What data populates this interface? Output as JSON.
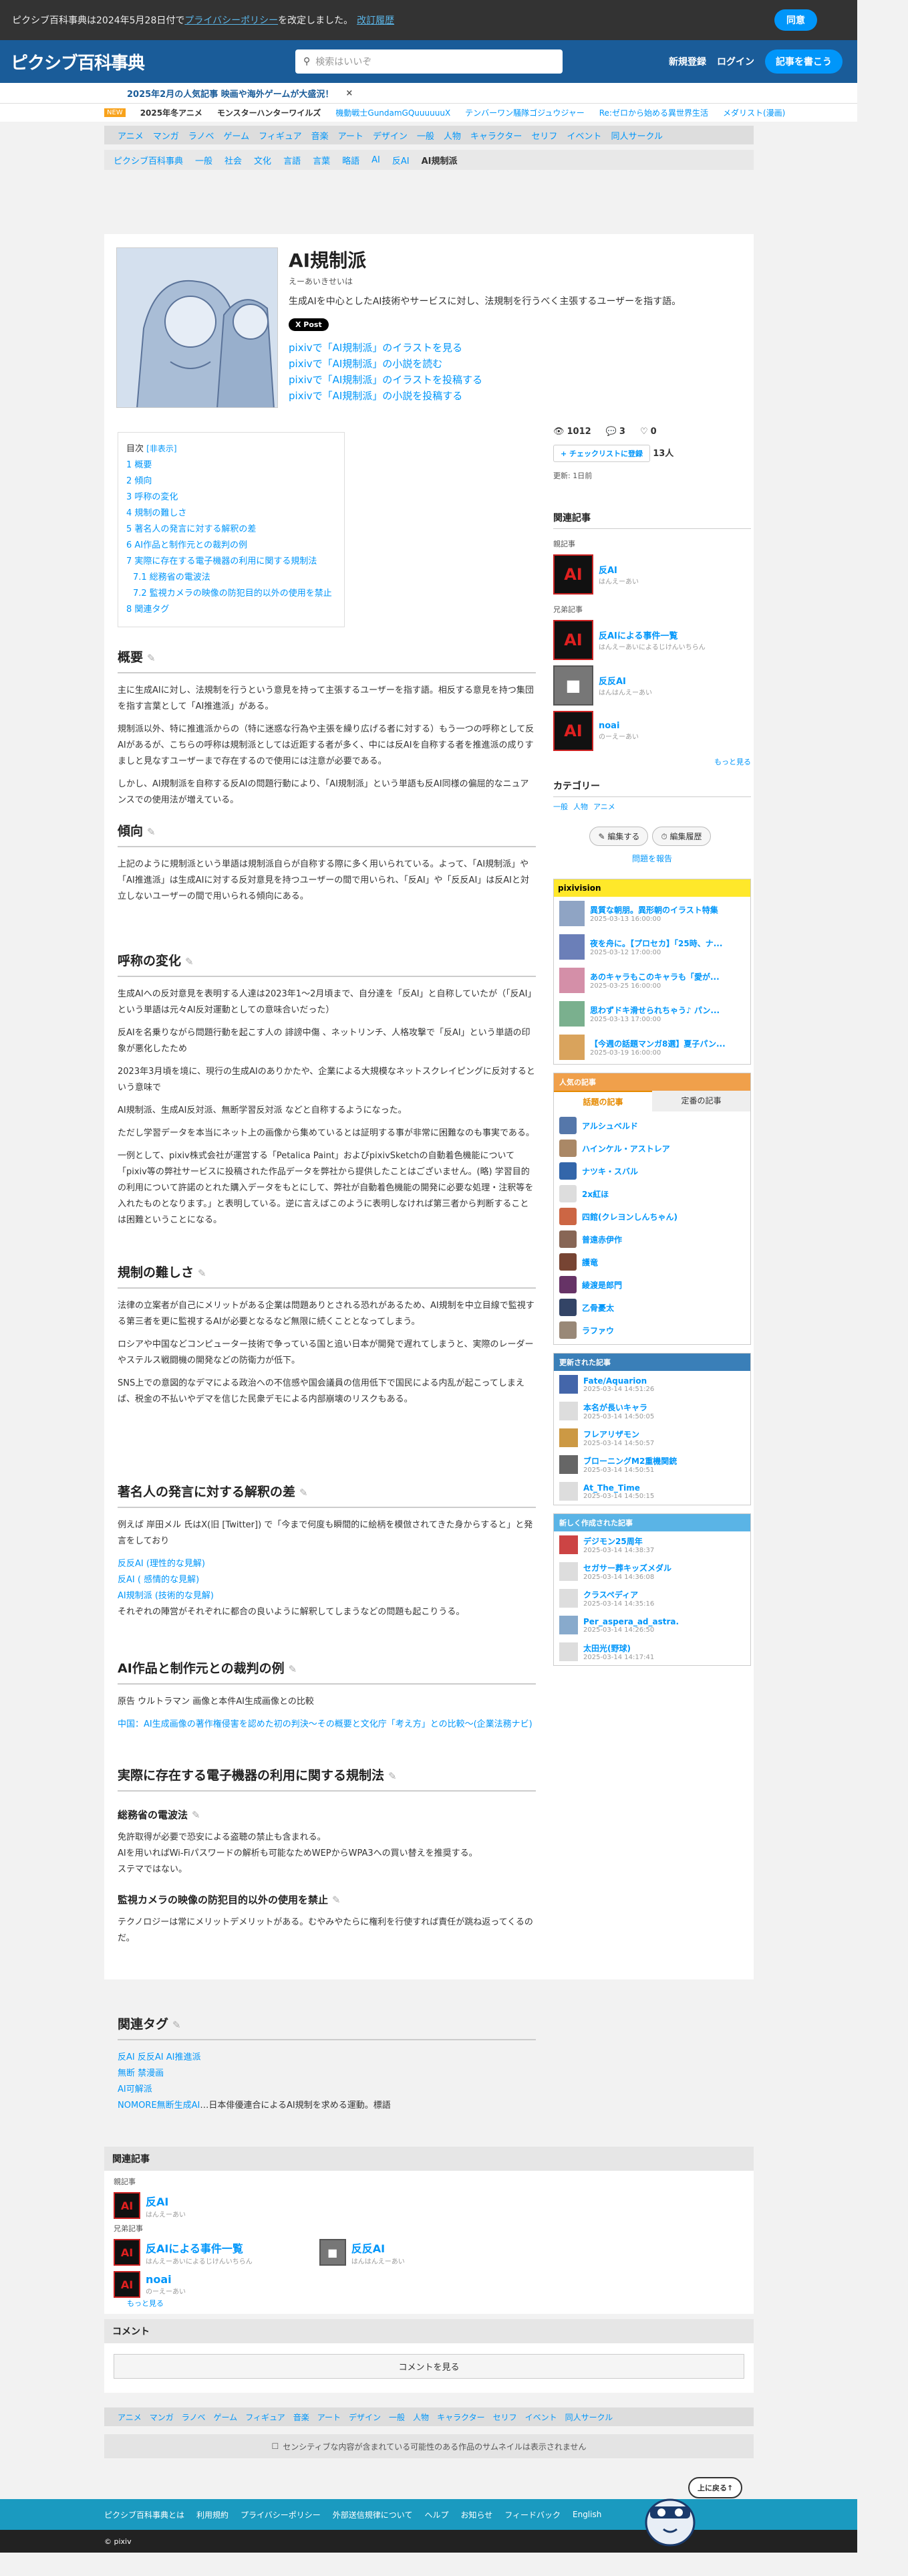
{
  "cookie": {
    "text": "ピクシブ百科事典は2024年5月28日付で",
    "link": "プライバシーポリシー",
    "text2": "を改定しました。",
    "history": "改訂履歴",
    "agree": "同意"
  },
  "header": {
    "logo": "ピクシブ百科事典",
    "search_placeholder": "検索はいいぞ",
    "register": "新規登録",
    "login": "ログイン",
    "write": "記事を書こう"
  },
  "promo": {
    "text": "2025年2月の人気記事 映画や海外ゲームが大盛況！",
    "close": "×"
  },
  "ticker": {
    "tag": "NEW",
    "items": [
      "2025年冬アニメ",
      "モンスターハンターワイルズ",
      "機動戦士GundamGQuuuuuuX",
      "テンバーワン騒隊ゴジュウジャー",
      "Re:ゼロから始める異世界生活",
      "メダリスト(漫画)"
    ]
  },
  "categories": [
    "アニメ",
    "マンガ",
    "ラノベ",
    "ゲーム",
    "フィギュア",
    "音楽",
    "アート",
    "デザイン",
    "一般",
    "人物",
    "キャラクター",
    "セリフ",
    "イベント",
    "同人サークル"
  ],
  "breadcrumb": [
    "ピクシブ百科事典",
    "一般",
    "社会",
    "文化",
    "言語",
    "言葉",
    "略語",
    "AI",
    "反AI",
    "AI規制派"
  ],
  "article": {
    "title": "AI規制派",
    "reading": "えーあいきせいは",
    "summary": "生成AIを中心としたAI技術やサービスに対し、法規制を行うべく主張するユーザーを指す語。",
    "post": "X Post",
    "pixiv_links": [
      "pixivで「AI規制派」のイラストを見る",
      "pixivで「AI規制派」の小説を読む",
      "pixivで「AI規制派」のイラストを投稿する",
      "pixivで「AI規制派」の小説を投稿する"
    ],
    "toc_title": "目次",
    "toc_toggle": "[非表示]",
    "toc": [
      "1 概要",
      "2 傾向",
      "3 呼称の変化",
      "4 規制の難しさ",
      "5 著名人の発言に対する解釈の差",
      "6 AI作品と制作元との裁判の例",
      "7 実際に存在する電子機器の利用に関する規制法"
    ],
    "toc_sub": [
      "7.1 総務省の電波法",
      "7.2 監視カメラの映像の防犯目的以外の使用を禁止"
    ],
    "toc_last": "8 関連タグ",
    "s1_title": "概要",
    "s1_p1": "主に生成AIに対し、法規制を行うという意見を持って主張するユーザーを指す語。相反する意見を持つ集団を指す言葉として「AI推進派」がある。",
    "s1_p2": "規制派以外、特に推進派からの（特に迷惑な行為や主張を繰り広げる者に対する）もう一つの呼称として反AIがあるが、こちらの呼称は規制派としては近距する者が多く、中には反AIを自称する者を推進派の成りすましと見なすユーザーまで存在するので使用には注意が必要である。",
    "s1_p3": "しかし、AI規制派を自称する反AIの問題行動により、「AI規制派」という単語も反AI同様の偏屈的なニュアンスでの使用法が増えている。",
    "s2_title": "傾向",
    "s2_p1": "上記のように規制派という単語は規制派自らが自称する際に多く用いられている。よって、「AI規制派」や「AI推進派」は生成AIに対する反対意見を持つユーザーの間で用いられ、「反AI」や「反反AI」は反AIと対立しないユーザーの間で用いられる傾向にある。",
    "s3_title": "呼称の変化",
    "s3_p1": "生成AIへの反対意見を表明する人達は2023年1〜2月頃まで、自分達を「反AI」と自称していたが（「反AI」という単語は元々AI反対運動としての意味合いだった）",
    "s3_p2": "反AIを名乗りながら問題行動を起こす人の 誹謗中傷 、ネットリンチ、人格攻撃で「反AI」という単語の印象が悪化したため",
    "s3_p3": "2023年3月頃を境に、現行の生成AIのありかたや、企業による大規模なネットスクレイピングに反対するという意味で",
    "s3_p4": "AI規制派、生成AI反対派、無断学習反対派 などと自称するようになった。",
    "s3_p5": "ただし学習データを本当にネット上の画像から集めているとは証明する事が非常に困難なのも事実である。",
    "s3_p6": "一例として、pixiv株式会社が運営する「Petalica Paint」およびpixivSketchの自動着色機能について「pixiv等の弊社サービスに投稿された作品データを弊社から提供したことはございません。(略) 学習目的の利用について許諾のとれた購入データをもとにして、弊社が自動着色機能の開発に必要な処理・注釈等を入れたものとなります。」と表明している。逆に言えばこのように表明しなければ第三者から判断することは困難ということになる。",
    "s4_title": "規制の難しさ",
    "s4_p1": "法律の立案者が自己にメリットがある企業は問題ありとされる恐れがあるため、AI規制を中立目線で監視する第三者を更に監視するAIが必要となるなど無限に続くこととなってしまう。",
    "s4_p2": "ロシアや中国などコンピューター技術で争っている国と追い日本が開発で遅れてしまうと、実際のレーダーやステルス戦闘機の開発などの防衛力が低下。",
    "s4_p3": "SNS上での意図的なデマによる政治への不信感や国会議員の信用低下で国民による内乱が起こってしまえば、税金の不払いやデマを信じた民衆デモによる内部崩壊のリスクもある。",
    "s5_title": "著名人の発言に対する解釈の差",
    "s5_p1": "例えば 岸田メル 氏はX(旧 [Twitter]) で「今まで何度も瞬間的に絵柄を模倣されてきた身からすると」と発言をしており",
    "s5_l1": "反反AI (理性的な見解)",
    "s5_l2": "反AI ( 感情的な見解)",
    "s5_l3": "AI規制派 (技術的な見解)",
    "s5_p2": "それぞれの陣営がそれぞれに都合の良いように解釈してしまうなどの問題も起こりうる。",
    "s6_title": "AI作品と制作元との裁判の例",
    "s6_p1": "原告 ウルトラマン 画像と本件AI生成画像との比較",
    "s6_p2": "中国：AI生成画像の著作権侵害を認めた初の判決〜その概要と文化庁「考え方」との比較〜(企業法務ナビ)",
    "s7_title": "実際に存在する電子機器の利用に関する規制法",
    "s71_title": "総務省の電波法",
    "s71_p1": "免許取得が必要で恐安による盗聴の禁止も含まれる。",
    "s71_p2": "AIを用いればWi-Fiパスワードの解析も可能なためWEPからWPA3への買い替えを推奨する。",
    "s71_p3": "ステマではない。",
    "s72_title": "監視カメラの映像の防犯目的以外の使用を禁止",
    "s72_p1": "テクノロジーは常にメリットデメリットがある。むやみやたらに権利を行使すれば責任が跳ね返ってくるのだ。",
    "s8_title": "関連タグ",
    "s8_l1": "反AI 反反AI AI推進派",
    "s8_l2": "無断 禁漫画",
    "s8_l3": "AI可解派",
    "s8_l4": "NOMORE無断生成AI",
    "s8_l4b": "…日本俳優連合によるAI規制を求める運動。標語"
  },
  "stats": {
    "views": "1012",
    "comments": "3",
    "likes": "0",
    "checklist": "チェックリストに登録",
    "check_count": "13人",
    "updated": "更新: 1日前"
  },
  "sidebar": {
    "related_title": "関連記事",
    "parent_label": "親記事",
    "parent": {
      "name": "反AI",
      "sub": "はんえーあい"
    },
    "sibling_label": "兄弟記事",
    "siblings": [
      {
        "name": "反AIによる事件一覧",
        "sub": "はんえーあいによるじけんいちらん"
      },
      {
        "name": "反反AI",
        "sub": "はんはんえーあい"
      },
      {
        "name": "noai",
        "sub": "のーえーあい"
      }
    ],
    "more": "もっと見る",
    "category_title": "カテゴリー",
    "category": [
      "一般",
      "人物",
      "アニメ"
    ],
    "edit": "編集する",
    "history": "編集履歴",
    "report": "問題を報告",
    "pixivision": "pixivision",
    "pv_items": [
      {
        "t": "異質な朝朋。異形朝のイラスト特集",
        "d": "2025-03-13 16:00:00"
      },
      {
        "t": "夜を舟に。【プロセカ】「25時、ナ...",
        "d": "2025-03-12 17:00:00"
      },
      {
        "t": "あのキャラもこのキャラも「愛が...",
        "d": "2025-03-25 16:00:00"
      },
      {
        "t": "思わずドキ滑せられちゃう♪ パン...",
        "d": "2025-03-13 17:00:00"
      },
      {
        "t": "【今週の話題マンガ8選】夏子パン...",
        "d": "2025-03-19 16:00:00"
      }
    ],
    "popular_title": "人気の記事",
    "tab_now": "話題の記事",
    "tab_past": "定番の記事",
    "popular": [
      "アルシュベルド",
      "ハインケル・アストレア",
      "ナツキ・スバル",
      "2x紅ほ",
      "四館(クレヨンしんちゃん)",
      "普遠赤伊作",
      "護竜",
      "綾渡是郎門",
      "乙骨憂太",
      "ラファウ"
    ],
    "updated_title": "更新された記事",
    "updated_items": [
      {
        "t": "Fate/Aquarion",
        "d": "2025-03-14 14:51:26"
      },
      {
        "t": "本名が長いキャラ",
        "d": "2025-03-14 14:50:05"
      },
      {
        "t": "フレアリザモン",
        "d": "2025-03-14 14:50:57"
      },
      {
        "t": "ブローニングM2重機関銃",
        "d": "2025-03-14 14:50:51"
      },
      {
        "t": "At_The_Time",
        "d": "2025-03-14 14:50:15"
      }
    ],
    "new_title": "新しく作成された記事",
    "new_items": [
      {
        "t": "デジモン25周年",
        "d": "2025-03-14 14:38:37"
      },
      {
        "t": "セガサー葬キッズメダル",
        "d": "2025-03-14 14:36:08"
      },
      {
        "t": "クラスペディア",
        "d": "2025-03-14 14:35:16"
      },
      {
        "t": "Per_aspera_ad_astra.",
        "d": "2025-03-14 14:26:50"
      },
      {
        "t": "太田光(野球)",
        "d": "2025-03-14 14:17:41"
      }
    ]
  },
  "bottom_related": {
    "title": "関連記事",
    "parent_label": "親記事",
    "sibling_label": "兄弟記事",
    "comment_title": "コメント",
    "comment_btn": "コメントを見る"
  },
  "footer": {
    "sensitive": "センシティブな内容が含まれている可能性のある作品のサムネイルは表示されません",
    "links": [
      "ピクシブ百科事典とは",
      "利用規約",
      "プライバシーポリシー",
      "外部送信規律について",
      "ヘルプ",
      "お知らせ",
      "フィードバック",
      "English"
    ],
    "copy": "© pixiv",
    "totop": "上に戻る↑"
  }
}
